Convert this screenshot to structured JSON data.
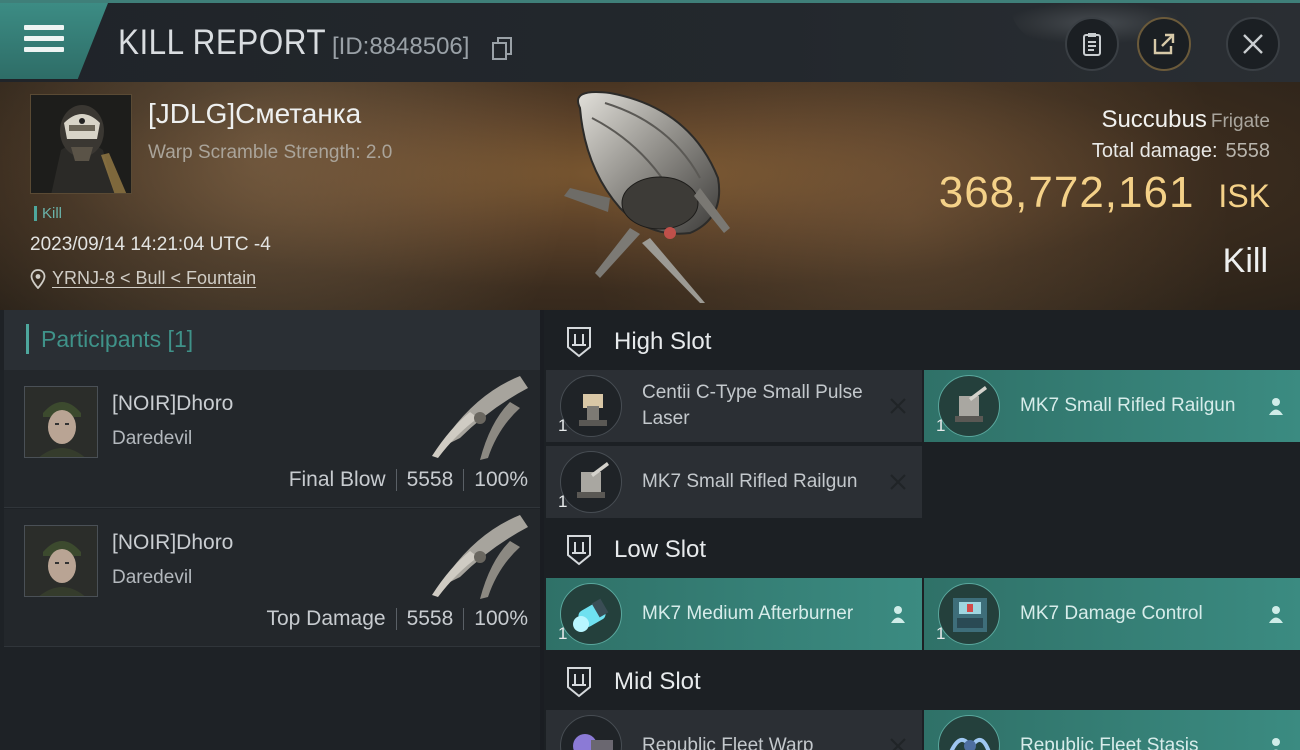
{
  "header": {
    "title": "KILL REPORT",
    "report_id": "[ID:8848506]"
  },
  "victim": {
    "name": "[JDLG]Сметанка",
    "subtitle": "Warp Scramble Strength: 2.0",
    "tag": "Kill",
    "timestamp": "2023/09/14 14:21:04 UTC -4",
    "location": "YRNJ-8 < Bull < Fountain"
  },
  "ship": {
    "name": "Succubus",
    "class": "Frigate",
    "total_damage_label": "Total damage:",
    "total_damage_value": "5558",
    "isk_value": "368,772,161",
    "isk_unit": "ISK",
    "result": "Kill"
  },
  "participants": {
    "label": "Participants [1]",
    "rows": [
      {
        "name": "[NOIR]Dhoro",
        "ship": "Daredevil",
        "role": "Final Blow",
        "damage": "5558",
        "percent": "100%"
      },
      {
        "name": "[NOIR]Dhoro",
        "ship": "Daredevil",
        "role": "Top Damage",
        "damage": "5558",
        "percent": "100%"
      }
    ]
  },
  "fitting": {
    "high_slot": {
      "title": "High Slot",
      "modules": [
        {
          "name": "Centii C-Type Small Pulse Laser",
          "qty": "1",
          "state": "destroyed"
        },
        {
          "name": "MK7 Small Rifled Railgun",
          "qty": "1",
          "state": "dropped"
        },
        {
          "name": "MK7 Small Rifled Railgun",
          "qty": "1",
          "state": "destroyed"
        }
      ]
    },
    "low_slot": {
      "title": "Low Slot",
      "modules": [
        {
          "name": "MK7 Medium Afterburner",
          "qty": "1",
          "state": "dropped"
        },
        {
          "name": "MK7 Damage Control",
          "qty": "1",
          "state": "dropped"
        }
      ]
    },
    "mid_slot": {
      "title": "Mid Slot",
      "modules": [
        {
          "name": "Republic Fleet Warp",
          "qty": "1",
          "state": "destroyed"
        },
        {
          "name": "Republic Fleet Stasis",
          "qty": "1",
          "state": "dropped"
        }
      ]
    }
  },
  "colors": {
    "accent": "#3f9289",
    "isk": "#f4d188",
    "fitted_module": "#3b8b81"
  },
  "icons": {
    "menu": "hamburger-icon",
    "copy": "copy-icon",
    "clipboard": "clipboard-icon",
    "share": "share-icon",
    "close": "close-icon",
    "location": "map-pin-icon",
    "slot": "slot-rack-icon",
    "destroyed": "x-mark-icon",
    "dropped": "person-icon"
  }
}
